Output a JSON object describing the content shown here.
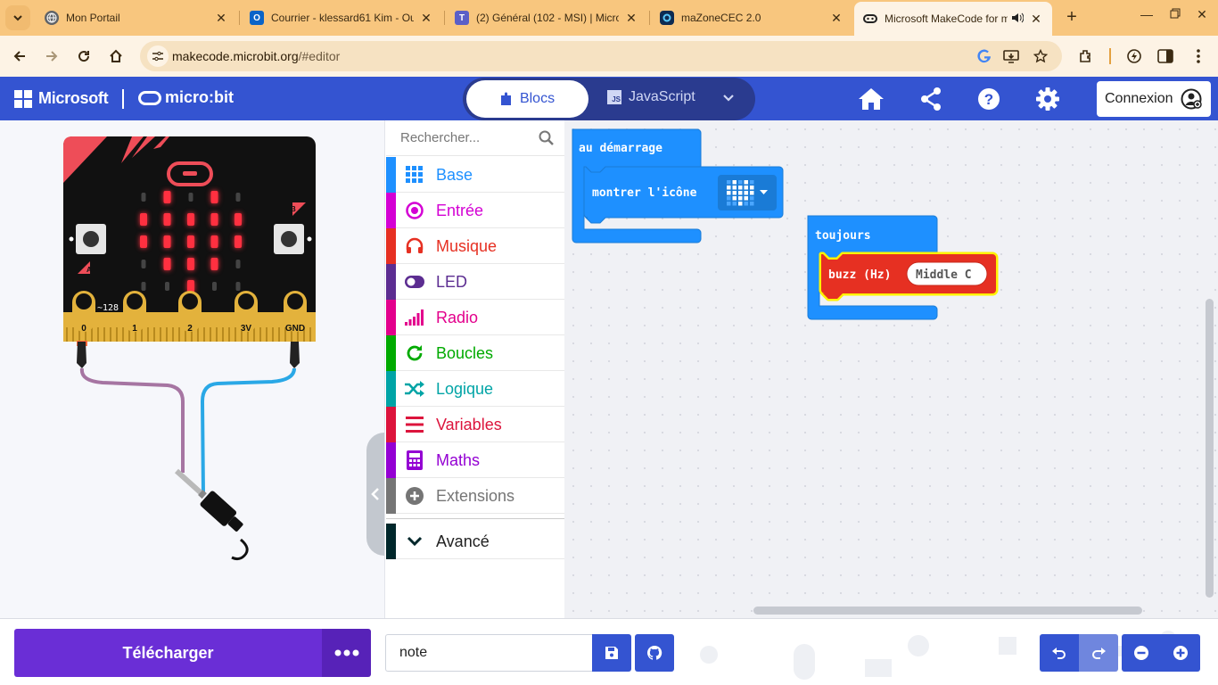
{
  "browser": {
    "tabs": [
      {
        "title": "Mon Portail",
        "icon": "globe-icon"
      },
      {
        "title": "Courrier - klessard61 Kim - Ou",
        "icon": "outlook-icon"
      },
      {
        "title": "(2) Général (102 - MSI) | Micro",
        "icon": "teams-icon"
      },
      {
        "title": "maZoneCEC 2.0",
        "icon": "mazone-icon"
      },
      {
        "title": "Microsoft MakeCode for m",
        "icon": "makecode-icon"
      }
    ],
    "url_host": "makecode.microbit.org",
    "url_path": "/#editor"
  },
  "header": {
    "brand": "Microsoft",
    "product": "micro:bit",
    "blocks_label": "Blocs",
    "javascript_label": "JavaScript",
    "connexion_label": "Connexion"
  },
  "simulator": {
    "pins": [
      "0",
      "1",
      "2",
      "3V",
      "GND"
    ],
    "pin0_value": "~128",
    "button_a": "A",
    "button_b": "B",
    "led_matrix": [
      [
        0,
        1,
        0,
        1,
        0
      ],
      [
        1,
        1,
        1,
        1,
        1
      ],
      [
        1,
        1,
        1,
        1,
        1
      ],
      [
        0,
        1,
        1,
        1,
        0
      ],
      [
        0,
        0,
        1,
        0,
        0
      ]
    ]
  },
  "toolbox": {
    "search_placeholder": "Rechercher...",
    "categories": [
      {
        "label": "Base",
        "color": "#1e90ff"
      },
      {
        "label": "Entrée",
        "color": "#d400d4"
      },
      {
        "label": "Musique",
        "color": "#e63022"
      },
      {
        "label": "LED",
        "color": "#5c2d91"
      },
      {
        "label": "Radio",
        "color": "#e3008c"
      },
      {
        "label": "Boucles",
        "color": "#00aa00"
      },
      {
        "label": "Logique",
        "color": "#00a4a6"
      },
      {
        "label": "Variables",
        "color": "#dc143c"
      },
      {
        "label": "Maths",
        "color": "#9400d3"
      },
      {
        "label": "Extensions",
        "color": "#757575"
      }
    ],
    "advanced_label": "Avancé",
    "advanced_color": "#00272b"
  },
  "workspace": {
    "on_start_label": "au démarrage",
    "show_icon_label": "montrer l'icône",
    "forever_label": "toujours",
    "buzz_label": "buzz (Hz)",
    "note_value": "Middle C"
  },
  "bottom": {
    "download_label": "Télécharger",
    "project_name": "note"
  }
}
